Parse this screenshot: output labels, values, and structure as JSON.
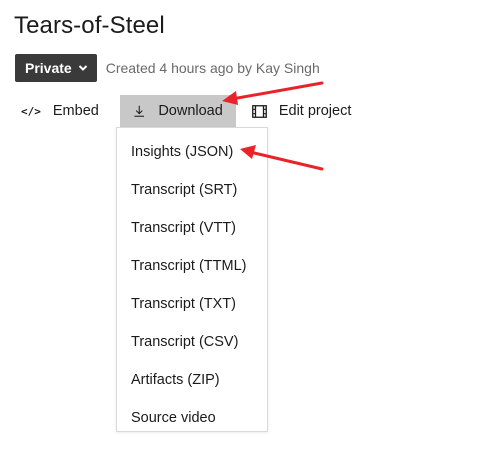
{
  "header": {
    "title": "Tears-of-Steel",
    "privacy_label": "Private",
    "created_text": "Created 4 hours ago by Kay Singh"
  },
  "toolbar": {
    "embed_label": "Embed",
    "download_label": "Download",
    "edit_label": "Edit project"
  },
  "download_menu": {
    "items": [
      "Insights (JSON)",
      "Transcript (SRT)",
      "Transcript (VTT)",
      "Transcript (TTML)",
      "Transcript (TXT)",
      "Transcript (CSV)",
      "Artifacts (ZIP)",
      "Source video"
    ]
  },
  "colors": {
    "annotation_arrow": "#e8242a",
    "privacy_button_bg": "#3a3a3a",
    "download_active_bg": "#c8c8c8"
  },
  "icons": {
    "embed": "code-icon",
    "download": "download-icon",
    "edit": "film-icon",
    "privacy_chevron": "chevron-down-icon"
  }
}
